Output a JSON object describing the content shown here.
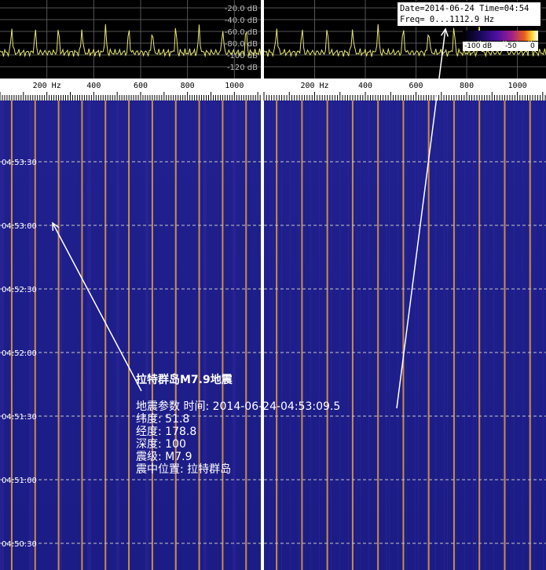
{
  "chart_data": {
    "type": "heatmap",
    "title": "",
    "panels": [
      {
        "name": "left",
        "x_ticks": [
          "200 Hz",
          "400",
          "600",
          "800",
          "1000"
        ],
        "x_tick_values": [
          200,
          400,
          600,
          800,
          1000
        ],
        "xlim": [
          0,
          1112.9
        ]
      },
      {
        "name": "right",
        "x_ticks": [
          "200 Hz",
          "400",
          "600",
          "800",
          "1000"
        ],
        "x_tick_values": [
          200,
          400,
          600,
          800,
          1000
        ],
        "xlim": [
          0,
          1112.9
        ]
      }
    ],
    "spectrum_db_labels": [
      "-20.0 dB",
      "-40.0 dB",
      "-60.0 dB",
      "-80.0 dB",
      "-100 dB",
      "-120 dB"
    ],
    "spectrum_db_values": [
      -20,
      -40,
      -60,
      -80,
      -100,
      -120
    ],
    "spectrum_db_range": [
      -120,
      0
    ],
    "time_ticks": [
      "04:53:30",
      "04:53:00",
      "04:52:30",
      "04:52:00",
      "04:51:30",
      "04:51:00",
      "04:50:30"
    ],
    "harmonic_lines_hz": [
      50,
      150,
      250,
      350,
      450,
      550,
      650,
      750,
      850,
      950,
      1050
    ],
    "grid": true
  },
  "info": {
    "date_line": "Date=2014-06-24 Time=04:54",
    "freq_line": "Freq= 0...1112.9 Hz"
  },
  "colorbar": {
    "labels": [
      "-100 dB",
      "-50",
      "0"
    ]
  },
  "annotation": {
    "title": "拉特群岛M7.9地震",
    "lines": [
      "地震参数 时间: 2014-06-24-04:53:09.5",
      "纬度: 51.8",
      "经度: 178.8",
      "深度: 100",
      "震级: M7.9",
      "震中位置: 拉特群岛"
    ]
  },
  "colors": {
    "background": "#1a1a8c",
    "harmonic": "#e8a040",
    "trace": "#e8e870",
    "grid": "#c8c8c8",
    "annotation": "#ffffff"
  }
}
